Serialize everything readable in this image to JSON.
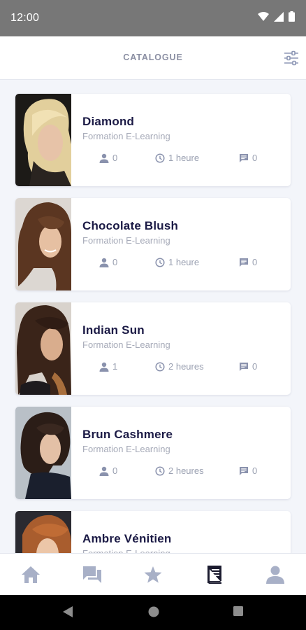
{
  "status_bar": {
    "time": "12:00"
  },
  "header": {
    "title": "CATALOGUE"
  },
  "courses": [
    {
      "title": "Diamond",
      "type": "Formation E-Learning",
      "users": "0",
      "duration": "1 heure",
      "comments": "0"
    },
    {
      "title": "Chocolate Blush",
      "type": "Formation E-Learning",
      "users": "0",
      "duration": "1 heure",
      "comments": "0"
    },
    {
      "title": "Indian Sun",
      "type": "Formation E-Learning",
      "users": "1",
      "duration": "2 heures",
      "comments": "0"
    },
    {
      "title": "Brun Cashmere",
      "type": "Formation E-Learning",
      "users": "0",
      "duration": "2 heures",
      "comments": "0"
    },
    {
      "title": "Ambre Vénitien",
      "type": "Formation E-Learning"
    }
  ],
  "bottom_nav": {
    "items": [
      {
        "icon": "home-icon"
      },
      {
        "icon": "chat-icon"
      },
      {
        "icon": "star-icon"
      },
      {
        "icon": "book-icon",
        "active": true
      },
      {
        "icon": "profile-icon"
      }
    ],
    "active_color": "#1b1b2f",
    "inactive_color": "#a8b0c7"
  },
  "colors": {
    "accent": "#1b1a45",
    "muted": "#9aa0b1",
    "status_bar": "#777777"
  }
}
